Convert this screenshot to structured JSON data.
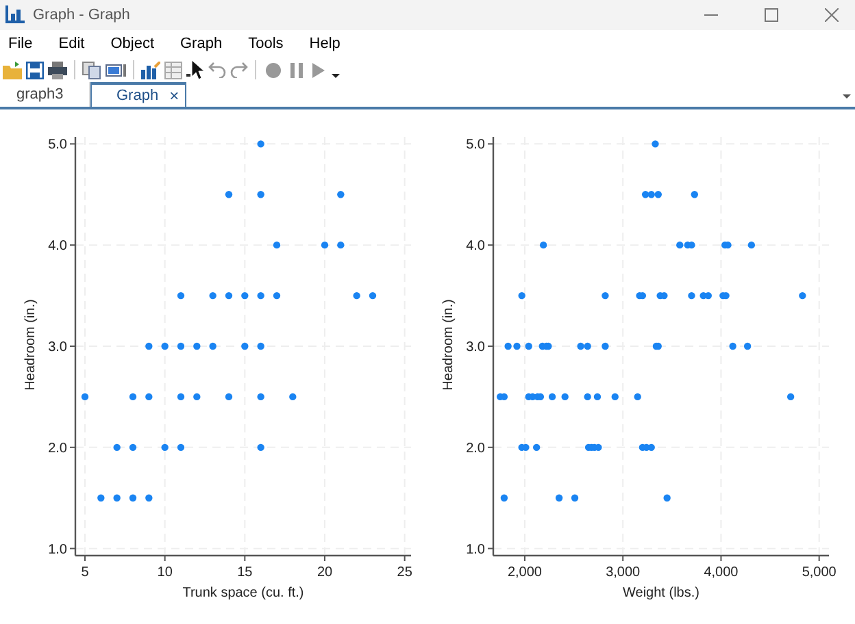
{
  "window": {
    "title": "Graph - Graph"
  },
  "menu": [
    "File",
    "Edit",
    "Object",
    "Graph",
    "Tools",
    "Help"
  ],
  "tabs": [
    {
      "label": "graph3",
      "selected": false
    },
    {
      "label": "Graph",
      "selected": true,
      "close": "×"
    }
  ],
  "graphs": [
    {
      "chart_data": {
        "type": "scatter",
        "xlabel": "Trunk space (cu. ft.)",
        "ylabel": "Headroom (in.)",
        "xlim": [
          4.4,
          25.4
        ],
        "ylim": [
          0.93,
          5.07
        ],
        "grid": true,
        "xticks": [
          5,
          10,
          15,
          20,
          25
        ],
        "yticks": [
          {
            "value": 1,
            "label": "1.0"
          },
          {
            "value": 2,
            "label": "2.0"
          },
          {
            "value": 3,
            "label": "3.0"
          },
          {
            "value": 4,
            "label": "4.0"
          },
          {
            "value": 5,
            "label": "5.0"
          }
        ],
        "series": [
          {
            "color": "#1a84f2",
            "x": [
              16,
              14,
              16,
              21,
              17,
              20,
              21,
              11,
              13,
              14,
              15,
              16,
              17,
              22,
              23,
              9,
              10,
              11,
              12,
              13,
              15,
              16,
              5,
              8,
              9,
              11,
              12,
              14,
              16,
              18,
              7,
              8,
              10,
              11,
              16,
              6,
              7,
              8,
              9
            ],
            "values": [
              5,
              4.5,
              4.5,
              4.5,
              4,
              4,
              4,
              3.5,
              3.5,
              3.5,
              3.5,
              3.5,
              3.5,
              3.5,
              3.5,
              3,
              3,
              3,
              3,
              3,
              3,
              3,
              2.5,
              2.5,
              2.5,
              2.5,
              2.5,
              2.5,
              2.5,
              2.5,
              2,
              2,
              2,
              2,
              2,
              1.5,
              1.5,
              1.5,
              1.5
            ]
          }
        ]
      }
    },
    {
      "chart_data": {
        "type": "scatter",
        "xlabel": "Weight (lbs.)",
        "ylabel": "Headroom (in.)",
        "xlim": [
          1679,
          5100
        ],
        "ylim": [
          0.93,
          5.07
        ],
        "grid": true,
        "xticks": [
          {
            "value": 2000,
            "label": "2,000"
          },
          {
            "value": 3000,
            "label": "3,000"
          },
          {
            "value": 4000,
            "label": "4,000"
          },
          {
            "value": 5000,
            "label": "5,000"
          }
        ],
        "yticks": [
          {
            "value": 1,
            "label": "1.0"
          },
          {
            "value": 2,
            "label": "2.0"
          },
          {
            "value": 3,
            "label": "3.0"
          },
          {
            "value": 4,
            "label": "4.0"
          },
          {
            "value": 5,
            "label": "5.0"
          }
        ],
        "series": [
          {
            "color": "#1a84f2",
            "x": [
              3330,
              3230,
              3290,
              3360,
              3730,
              2190,
              3580,
              3660,
              3700,
              4040,
              4070,
              4310,
              1970,
              2820,
              3170,
              3200,
              3380,
              3420,
              3700,
              3820,
              3870,
              4020,
              4050,
              4830,
              1830,
              1920,
              2040,
              2180,
              2220,
              2240,
              2570,
              2640,
              2820,
              3340,
              3360,
              4120,
              4270,
              1750,
              1790,
              2040,
              2080,
              2130,
              2160,
              2280,
              2410,
              2640,
              2740,
              2920,
              3150,
              4710,
              1970,
              2010,
              2120,
              2650,
              2680,
              2710,
              2750,
              3200,
              3240,
              3290,
              1790,
              2350,
              2510,
              3450
            ],
            "values": [
              5,
              4.5,
              4.5,
              4.5,
              4.5,
              4,
              4,
              4,
              4,
              4,
              4,
              4,
              3.5,
              3.5,
              3.5,
              3.5,
              3.5,
              3.5,
              3.5,
              3.5,
              3.5,
              3.5,
              3.5,
              3.5,
              3,
              3,
              3,
              3,
              3,
              3,
              3,
              3,
              3,
              3,
              3,
              3,
              3,
              2.5,
              2.5,
              2.5,
              2.5,
              2.5,
              2.5,
              2.5,
              2.5,
              2.5,
              2.5,
              2.5,
              2.5,
              2.5,
              2,
              2,
              2,
              2,
              2,
              2,
              2,
              2,
              2,
              2,
              1.5,
              1.5,
              1.5,
              1.5
            ]
          }
        ]
      }
    }
  ]
}
